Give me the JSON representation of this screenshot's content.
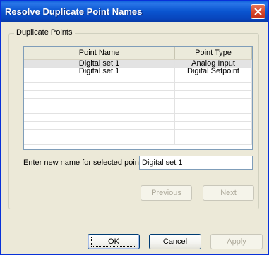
{
  "window": {
    "title": "Resolve Duplicate Point Names"
  },
  "group": {
    "label": "Duplicate Points"
  },
  "table": {
    "columns": [
      "Point Name",
      "Point Type"
    ],
    "rows": [
      {
        "name": "Digital set 1",
        "type": "Analog Input"
      },
      {
        "name": "Digital set 1",
        "type": "Digital Setpoint"
      },
      {
        "name": "",
        "type": ""
      },
      {
        "name": "",
        "type": ""
      },
      {
        "name": "",
        "type": ""
      },
      {
        "name": "",
        "type": ""
      },
      {
        "name": "",
        "type": ""
      },
      {
        "name": "",
        "type": ""
      },
      {
        "name": "",
        "type": ""
      },
      {
        "name": "",
        "type": ""
      },
      {
        "name": "",
        "type": ""
      }
    ]
  },
  "rename": {
    "label": "Enter new name for selected point",
    "value": "Digital set 1"
  },
  "nav": {
    "previous_label": "Previous",
    "next_label": "Next"
  },
  "footer": {
    "ok_label": "OK",
    "cancel_label": "Cancel",
    "apply_label": "Apply"
  },
  "colors": {
    "titlebar": "#0a55d0",
    "dialog_bg": "#ece9d8",
    "close_button": "#d6442b",
    "selected_row": "#e3e3e3"
  }
}
